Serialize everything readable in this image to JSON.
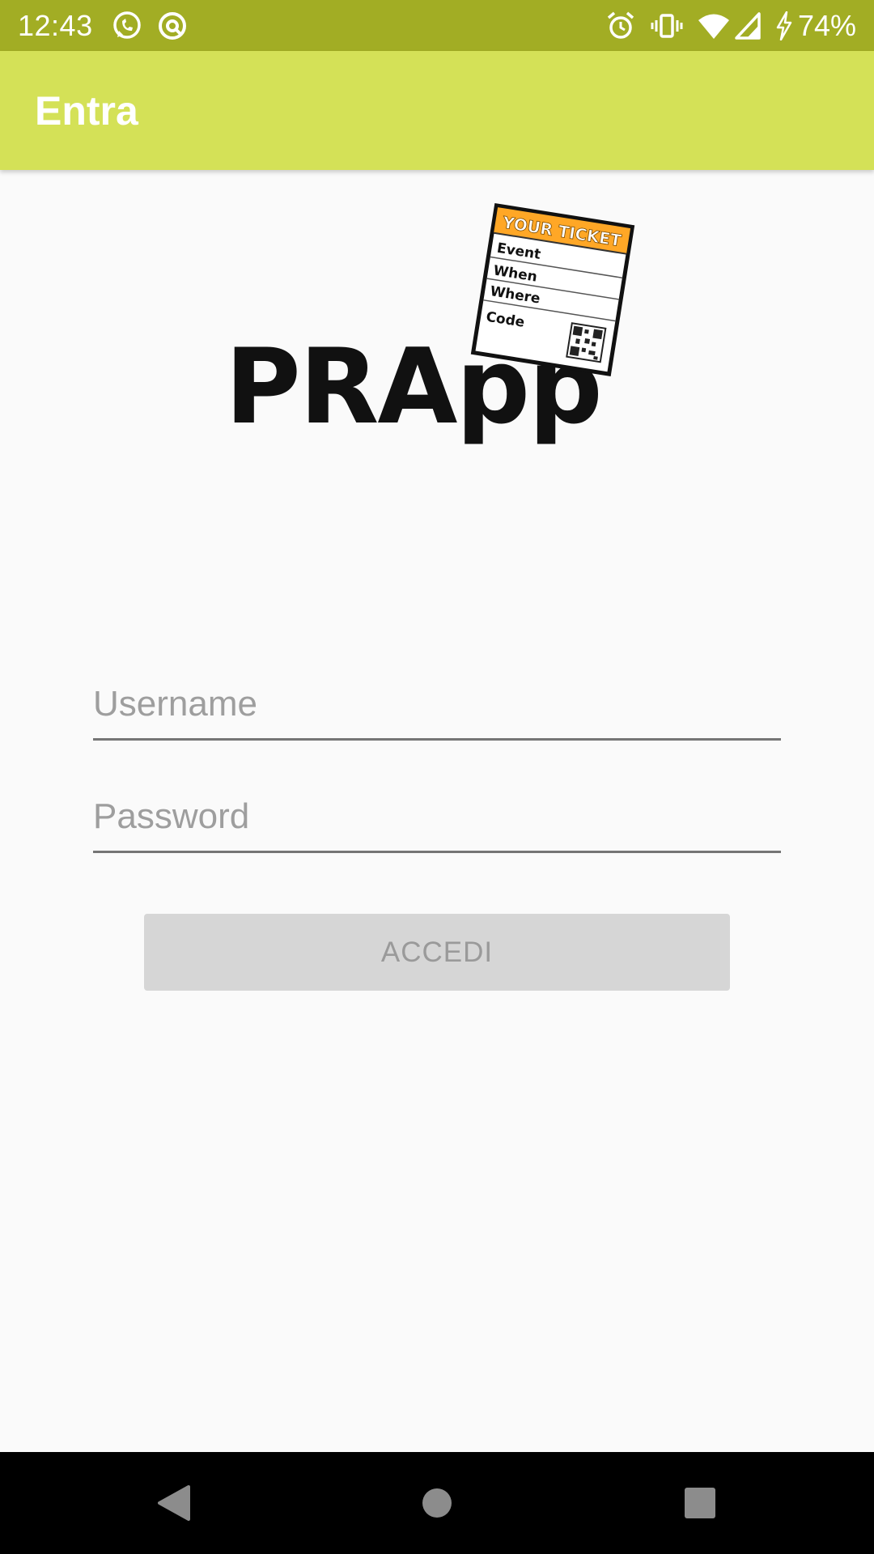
{
  "status_bar": {
    "time": "12:43",
    "battery": "74%",
    "background": "#a2ad24",
    "left_icons": [
      "whatsapp-icon",
      "notification-app-icon"
    ],
    "right_icons": [
      "alarm-icon",
      "vibrate-icon",
      "wifi-icon",
      "cell-signal-icon",
      "charging-icon"
    ]
  },
  "app_bar": {
    "title": "Entra",
    "background": "#d4e157"
  },
  "logo": {
    "text": "PRApp",
    "ticket": {
      "header": "YOUR TICKET",
      "rows": [
        "Event",
        "When",
        "Where",
        "Code"
      ],
      "header_color": "#ffa726",
      "icon": "qr-code-icon"
    }
  },
  "form": {
    "username_placeholder": "Username",
    "username_value": "",
    "password_placeholder": "Password",
    "password_value": "",
    "login_label": "ACCEDI"
  },
  "nav_bar": {
    "icons": [
      "back-icon",
      "home-icon",
      "recent-apps-icon"
    ]
  }
}
